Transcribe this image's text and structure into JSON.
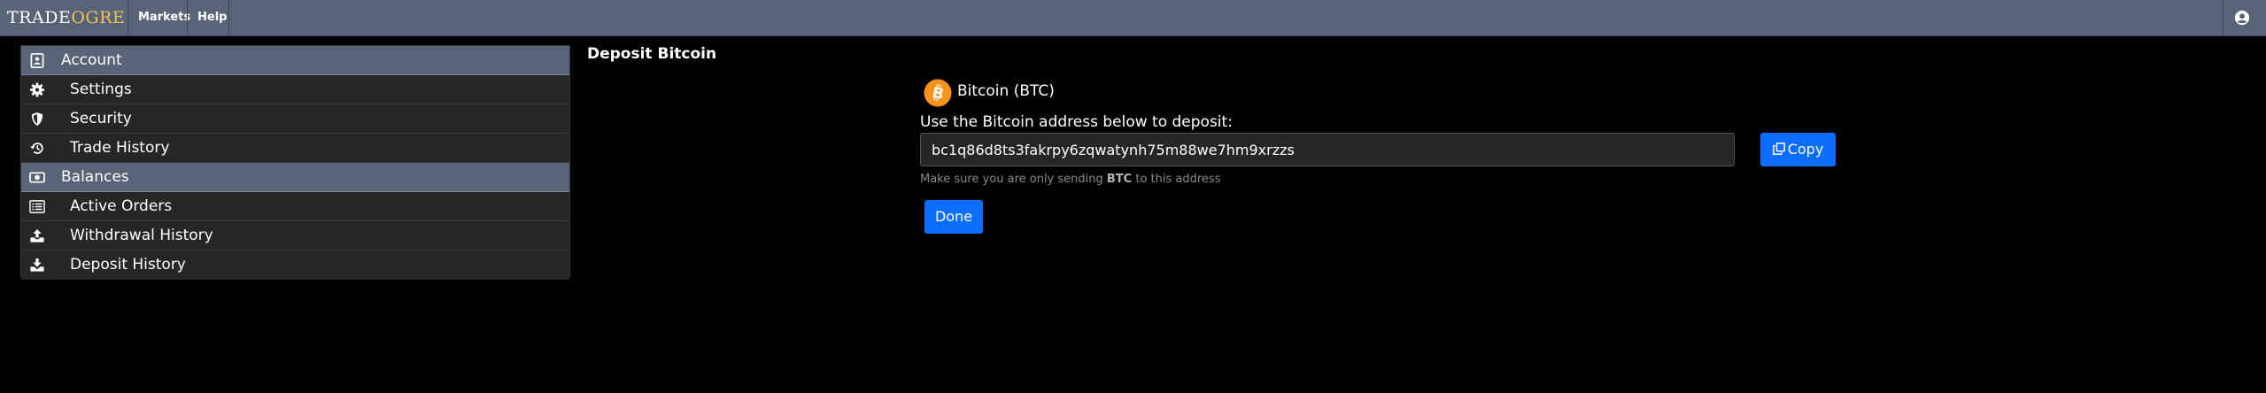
{
  "app": {
    "logo_main": "TRADE",
    "logo_accent": "OGRE"
  },
  "nav": {
    "markets": "Markets",
    "help": "Help"
  },
  "sidebar": {
    "account_header": "Account",
    "account_items": [
      {
        "label": "Settings",
        "icon": "gear-icon"
      },
      {
        "label": "Security",
        "icon": "shield-icon"
      },
      {
        "label": "Trade History",
        "icon": "history-icon"
      }
    ],
    "balances_header": "Balances",
    "balance_items": [
      {
        "label": "Active Orders",
        "icon": "list-icon"
      },
      {
        "label": "Withdrawal History",
        "icon": "upload-icon"
      },
      {
        "label": "Deposit History",
        "icon": "download-icon"
      }
    ]
  },
  "deposit": {
    "title": "Deposit Bitcoin",
    "coin_name": "Bitcoin (BTC)",
    "address_label": "Use the Bitcoin address below to deposit:",
    "address": "bc1q86d8ts3fakrpy6zqwatynh75m88we7hm9xrzzs",
    "copy_label": "Copy",
    "hint_prefix": "Make sure you are only sending",
    "hint_coin": "BTC",
    "hint_suffix": "to this address",
    "done_label": "Done"
  },
  "colors": {
    "nav_bg": "#5a6478",
    "accent_blue": "#0d6efd",
    "bitcoin_orange": "#f7931a",
    "logo_accent": "#e8c45a"
  }
}
